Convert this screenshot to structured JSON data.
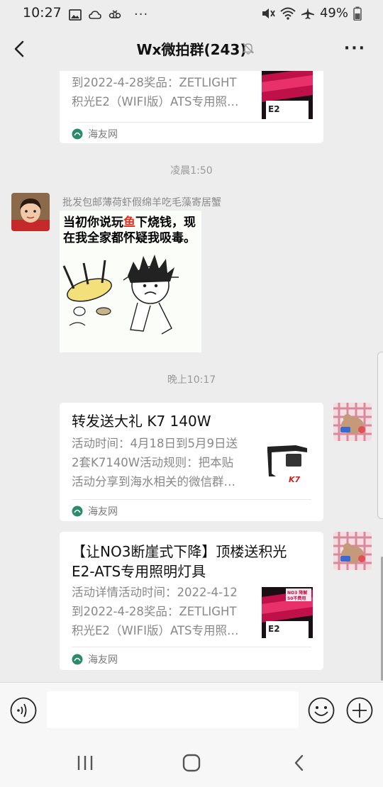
{
  "status_bar": {
    "time": "10:27",
    "battery": "49%",
    "more": "···"
  },
  "nav": {
    "title": "Wx微拍群(243)",
    "more": "···"
  },
  "messages": {
    "card_top": {
      "desc_line1": "到2022-4-28奖品：ZETLIGHT",
      "desc_line2": "积光E2（WIFI版）ATS专用照…",
      "source": "海友网",
      "thumb_label": "E2"
    },
    "time_1": "凌晨1:50",
    "sender_1": {
      "name": "批发包邮薄荷虾假绵羊吃毛藻寄居蟹",
      "sticker_text_a": "当初你说玩",
      "sticker_text_red": "鱼",
      "sticker_text_b": "下烧钱，现在我全家都怀疑我吸毒。"
    },
    "time_2": "晚上10:17",
    "card_k7": {
      "title": "转发送大礼 K7 140W",
      "desc_line1": "活动时间：4月18日到5月9日送",
      "desc_line2": "2套K7140W活动规则：把本贴",
      "desc_line3": "活动分享到海水相关的微信群…",
      "source": "海友网"
    },
    "card_no3": {
      "title_line1": "【让NO3断崖式下降】顶楼送积光",
      "title_line2": "E2-ATS专用照明灯具",
      "desc_line1": "活动详情活动时间：2022-4-12",
      "desc_line2": "到2022-4-28奖品：ZETLIGHT",
      "desc_line3": "积光E2（WIFI版）ATS专用照…",
      "source": "海友网",
      "thumb_label": "E2",
      "thumb_tag": "NO3 降解 50不费用"
    }
  },
  "input": {
    "value": "",
    "placeholder": ""
  },
  "colors": {
    "background": "#ededed",
    "bubble": "#ffffff",
    "source_icon": "#2a8a6a",
    "thumb_red": "#c0104a"
  }
}
